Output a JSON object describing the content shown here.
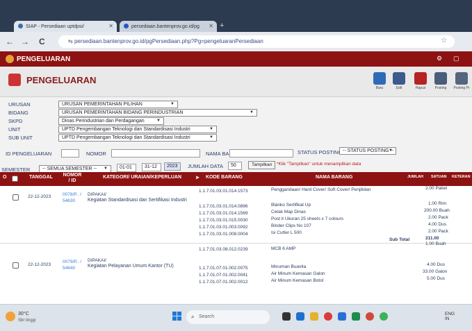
{
  "browser": {
    "tabs": [
      {
        "label": "SIAP - Persediaan uptdpsi/"
      },
      {
        "label": "persediaan.bantenprov.go.id/pg"
      }
    ],
    "new_tab": "+",
    "nav": {
      "back": "←",
      "forward": "→",
      "reload": "C"
    },
    "url": {
      "site_icon": "⇆",
      "text": "persediaan.bantenprov.go.id/pgPersediaan.php?Pg=pengeluaranPersediaan"
    }
  },
  "app": {
    "header_title": "PENGELUARAN",
    "page_title": "PENGELUARAN",
    "toolbar": [
      {
        "label": "Baru",
        "icon": "new-icon"
      },
      {
        "label": "Edit",
        "icon": "edit-icon"
      },
      {
        "label": "Hapus",
        "icon": "delete-icon"
      },
      {
        "label": "Posting",
        "icon": "posting-icon"
      },
      {
        "label": "Posting Pr",
        "icon": "posting-print-icon"
      }
    ]
  },
  "filters": {
    "urusan": {
      "label": "URUSAN",
      "value": "URUSAN PEMERINTAHAN PILIHAN"
    },
    "bidang": {
      "label": "BIDANG",
      "value": "URUSAN PEMERINTAHAN BIDANG PERINDUSTRIAN"
    },
    "skpd": {
      "label": "SKPD",
      "value": "Dinas Perindustrian dan Perdagangan"
    },
    "unit": {
      "label": "UNIT",
      "value": "UPTD Pengembangan Teknologi dan Standardisasi Industri"
    },
    "sub_unit": {
      "label": "SUB UNIT",
      "value": "UPTD Pengembangan Teknologi dan Standardisasi Industri"
    },
    "id_pengeluaran": {
      "label": "ID PENGELUARAN",
      "value": ""
    },
    "nomor": {
      "label": "NOMOR",
      "value": ""
    },
    "nama_barang": {
      "label": "NAMA BARANG",
      "value": ""
    },
    "status_posting": {
      "label": "STATUS POSTING",
      "value": "-- STATUS POSTING --"
    },
    "semester": {
      "label": "SEMESTER",
      "value": "-- SEMUA SEMESTER --"
    },
    "date_from": "01-01",
    "date_to": "31-12",
    "year": "2023",
    "jumlah_data": {
      "label": "JUMLAH DATA",
      "value": "50"
    },
    "tampilkan_button": "Tampilkan",
    "hint": "*Klik \"Tampilkan\" untuk menampilkan data"
  },
  "table": {
    "headers": {
      "no": "O",
      "tanggal": "TANGGAL",
      "nomor_id": "NOMOR / ID",
      "kategori": "KATEGORI/ URAIAN/KEPERLUAN",
      "kode_barang": "KODE BARANG",
      "nama_barang": "NAMA BARANG",
      "jumlah": "JUMLAH",
      "satuan": "SATUAN",
      "keterangan": "KETERAN"
    },
    "groups": [
      {
        "tanggal": "22-12-2023",
        "nomor": "0078/P.. /",
        "id": "54630",
        "kategori": "DIPAKAI/",
        "uraian": "Kegiatan Standardisasi dan Sertifikasi Industri",
        "items": [
          {
            "kode": "1.1.7.01.03.01.014.1573",
            "nama": "Penggandaan/ Hard Cover/ Soft Cover/ Penjilidan",
            "qty": "2.00 Paket"
          },
          {
            "kode": "1.1.7.01.03.01.014.0896",
            "nama": "Blanko Sertifikat Up",
            "qty": "1.00 Rim"
          },
          {
            "kode": "1.1.7.01.03.01.014.1569",
            "nama": "Cetak Map Dinas",
            "qty": "200.00 Buah"
          },
          {
            "kode": "1.1.7.01.03.01.015.0030",
            "nama": "Post it Ukuran 25 sheets x 7 colours",
            "qty": "2.00 Pack"
          },
          {
            "kode": "1.1.7.01.03.01.003.0092",
            "nama": "Binder Clips No 107",
            "qty": "4.00 Dus"
          },
          {
            "kode": "1.1.7.01.03.01.008.0004",
            "nama": "Isi Cutter L 500",
            "qty": "2.00 Pack"
          }
        ],
        "subtotal_label": "Sub Total",
        "subtotal": "211.00"
      },
      {
        "tanggal": "22-12-2023",
        "nomor": "0079/P.. /",
        "id": "54640",
        "kategori": "DIPAKAI/",
        "uraian": "Kegiatan Pelayanan Umum Kantor (TU)",
        "items": [
          {
            "kode": "1.1.7.01.03.08.012.0239",
            "nama": "MCB 6 AMP",
            "qty": "1.00 Buah"
          },
          {
            "kode": "1.1.7.01.07.01.002.0075",
            "nama": "Minuman Buavita",
            "qty": "4.00 Dus"
          },
          {
            "kode": "1.1.7.01.07.01.002.0041",
            "nama": "Air Minum Kemasan Galon",
            "qty": "33.00 Galon"
          },
          {
            "kode": "1.1.7.01.07.01.002.0012",
            "nama": "Air Minum Kemasan Botol",
            "qty": "5.00 Dus"
          }
        ]
      }
    ]
  },
  "taskbar": {
    "weather_temp": "30°C",
    "weather_cond": "Sbr tinggi",
    "search_placeholder": "Search",
    "tray_lang": "ENG\nIN"
  },
  "colors": {
    "brand": "#8d1212",
    "link": "#3b7bd6",
    "label": "#2a3c6b"
  }
}
